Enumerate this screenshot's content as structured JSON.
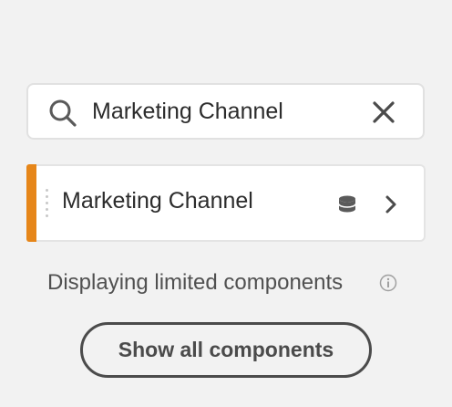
{
  "search": {
    "value": "Marketing Channel",
    "icon": "search-icon",
    "clear_icon": "close-icon"
  },
  "results": [
    {
      "label": "Marketing Channel",
      "accent_color": "#e68619",
      "type_icon": "database-icon",
      "action_icon": "chevron-right-icon"
    }
  ],
  "footer": {
    "limited_text": "Displaying limited components",
    "info_icon": "info-icon",
    "show_all_label": "Show all components"
  }
}
